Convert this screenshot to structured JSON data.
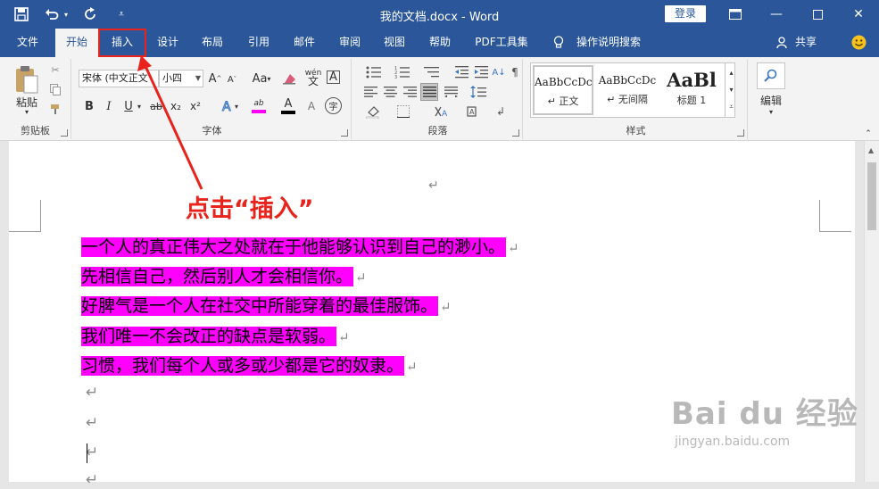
{
  "window": {
    "title": "我的文档.docx - Word",
    "login": "登录"
  },
  "qat": {
    "save": "save-icon",
    "undo": "undo-icon",
    "redo": "redo-icon",
    "customize": "customize-icon"
  },
  "tabs": [
    "文件",
    "开始",
    "插入",
    "设计",
    "布局",
    "引用",
    "邮件",
    "审阅",
    "视图",
    "帮助",
    "PDF工具集",
    "操作说明搜索"
  ],
  "active_tab": "开始",
  "share_label": "共享",
  "ribbon": {
    "clipboard": {
      "label": "剪贴板",
      "paste": "粘贴"
    },
    "font": {
      "label": "字体",
      "font_name": "宋体 (中文正文",
      "font_size": "小四",
      "bold": "B",
      "italic": "I",
      "underline": "U",
      "subscript": "x₂",
      "superscript": "x²",
      "grow": "A",
      "shrink": "A",
      "case": "Aa",
      "phonetic": "wén",
      "border_char": "A",
      "highlight": "ab",
      "color": "A",
      "encircle": "字",
      "strikethrough": "ab"
    },
    "paragraph": {
      "label": "段落"
    },
    "styles": {
      "label": "样式",
      "items": [
        {
          "sample": "AaBbCcDc",
          "name": "正文"
        },
        {
          "sample": "AaBbCcDc",
          "name": "无间隔"
        },
        {
          "sample": "AaBl",
          "name": "标题 1"
        }
      ]
    },
    "editing": {
      "label": "编辑"
    }
  },
  "annotation": "点击“插入”",
  "document": {
    "paragraphs": [
      "一个人的真正伟大之处就在于他能够认识到自己的渺小。",
      "先相信自己，然后别人才会相信你。",
      "好脾气是一个人在社交中所能穿着的最佳服饰。",
      "我们唯一不会改正的缺点是软弱。",
      "习惯，我们每个人或多或少都是它的奴隶。"
    ],
    "highlight_color": "#ff00ff",
    "paragraph_mark": "↵"
  },
  "watermark": {
    "logo": "Bai du 经验",
    "url": "jingyan.baidu.com"
  },
  "colors": {
    "brand": "#2b579a",
    "annotation": "#e8231b"
  }
}
